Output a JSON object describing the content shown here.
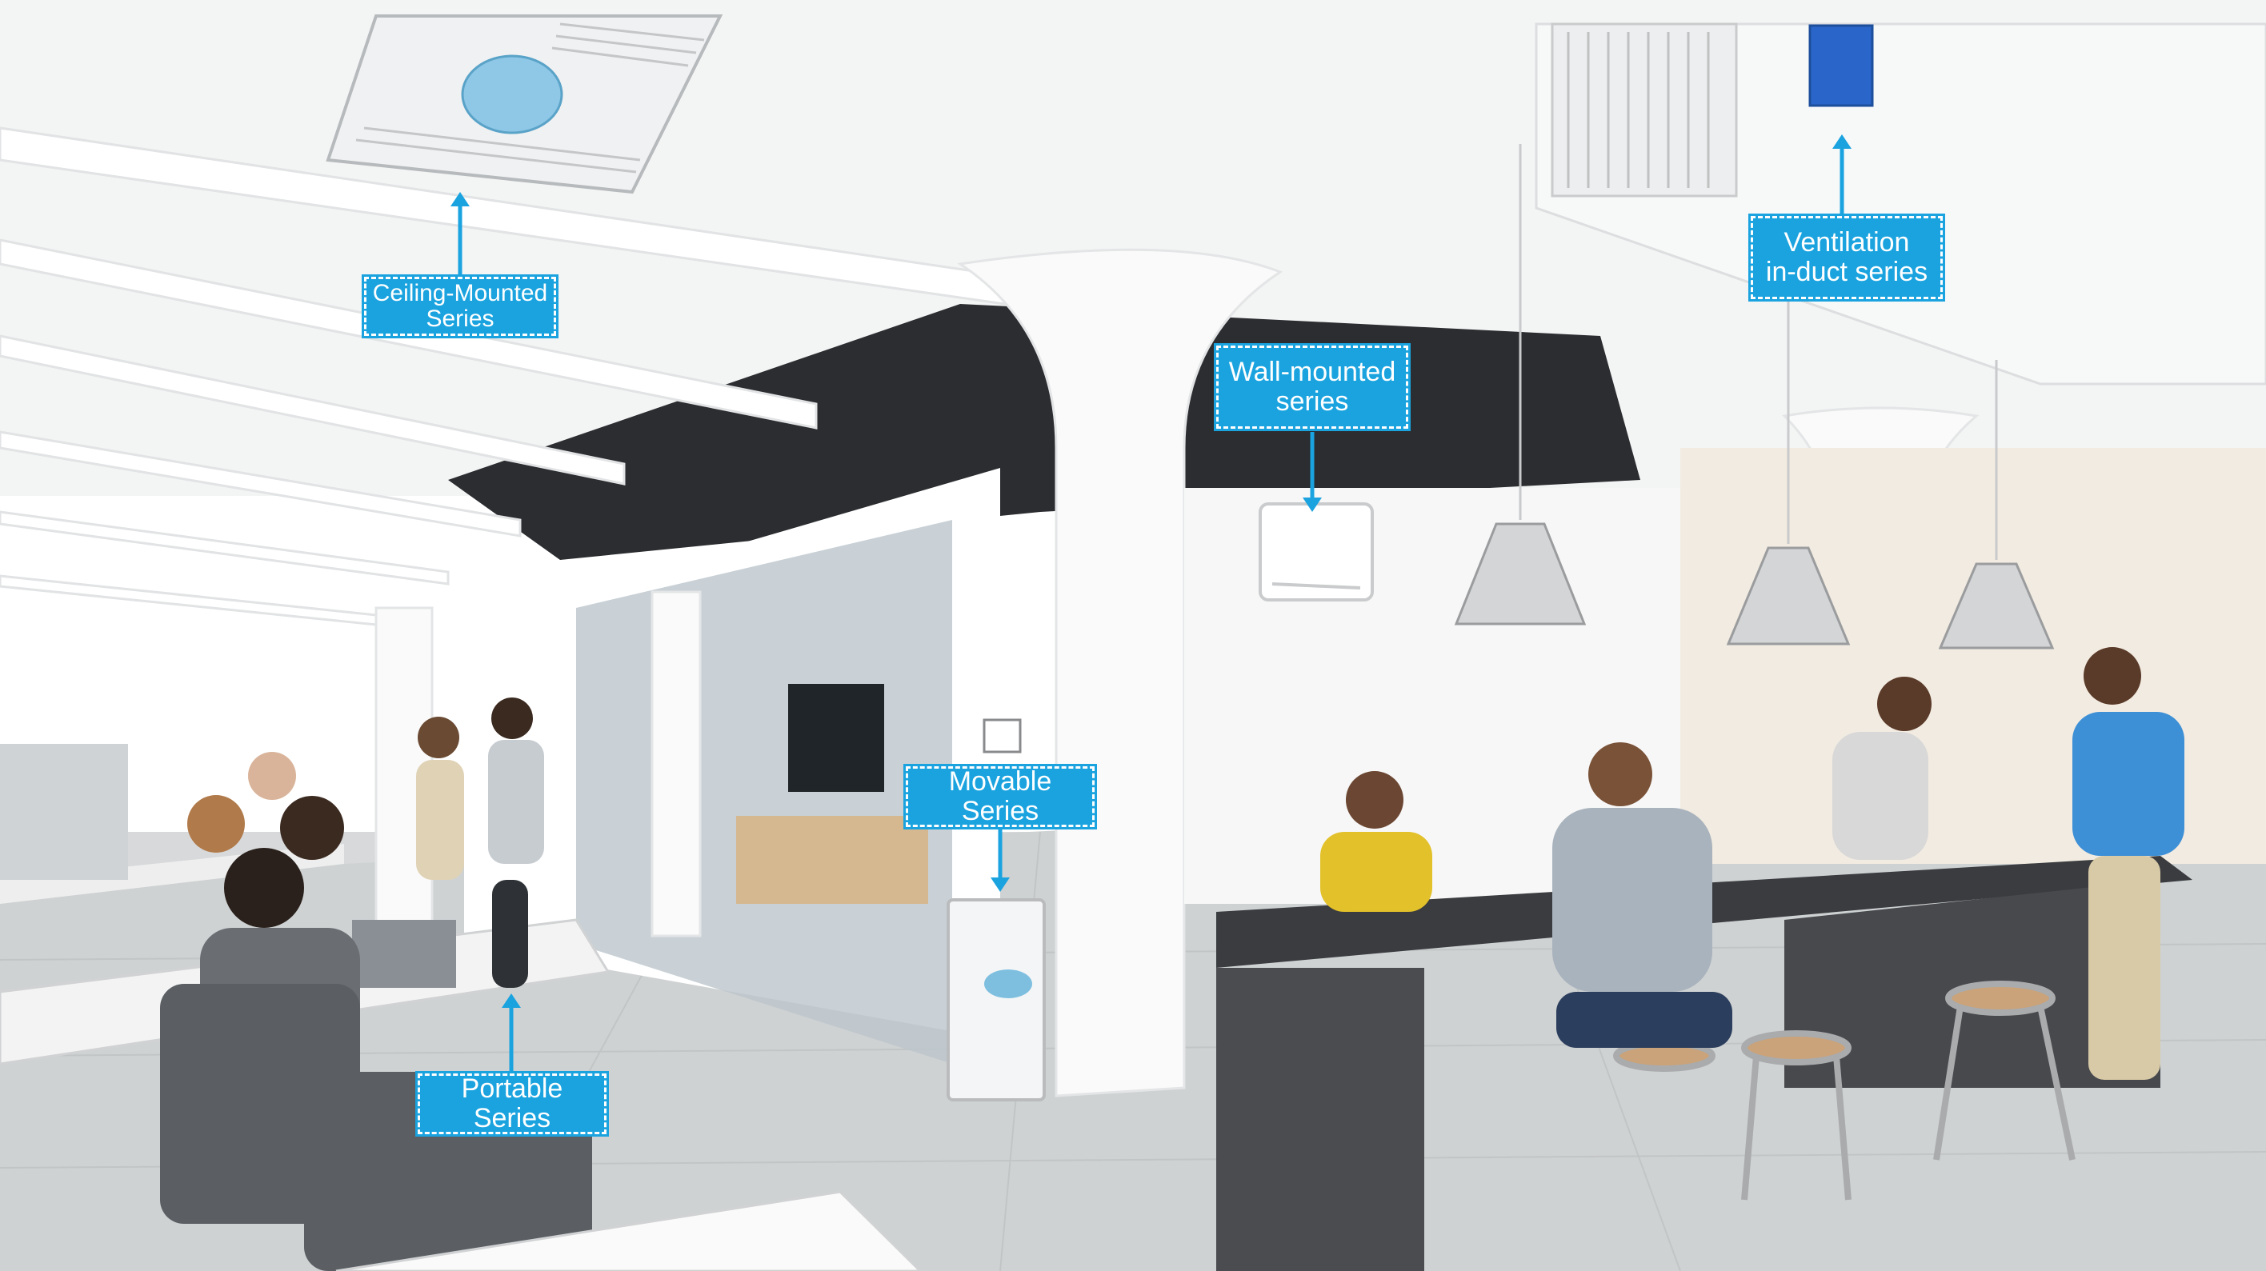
{
  "labels": {
    "ceiling": "Ceiling-Mounted Series",
    "ventilation_line1": "Ventilation",
    "ventilation_line2": "in-duct series",
    "wall_line1": "Wall-mounted",
    "wall_line2": "series",
    "movable": "Movable Series",
    "portable": "Portable Series"
  },
  "colors": {
    "label_background": "#1aa3df",
    "label_text": "#ffffff",
    "arrow": "#1aa3df"
  },
  "icons": {
    "arrow": "arrow-up-icon / arrow-down-icon"
  }
}
